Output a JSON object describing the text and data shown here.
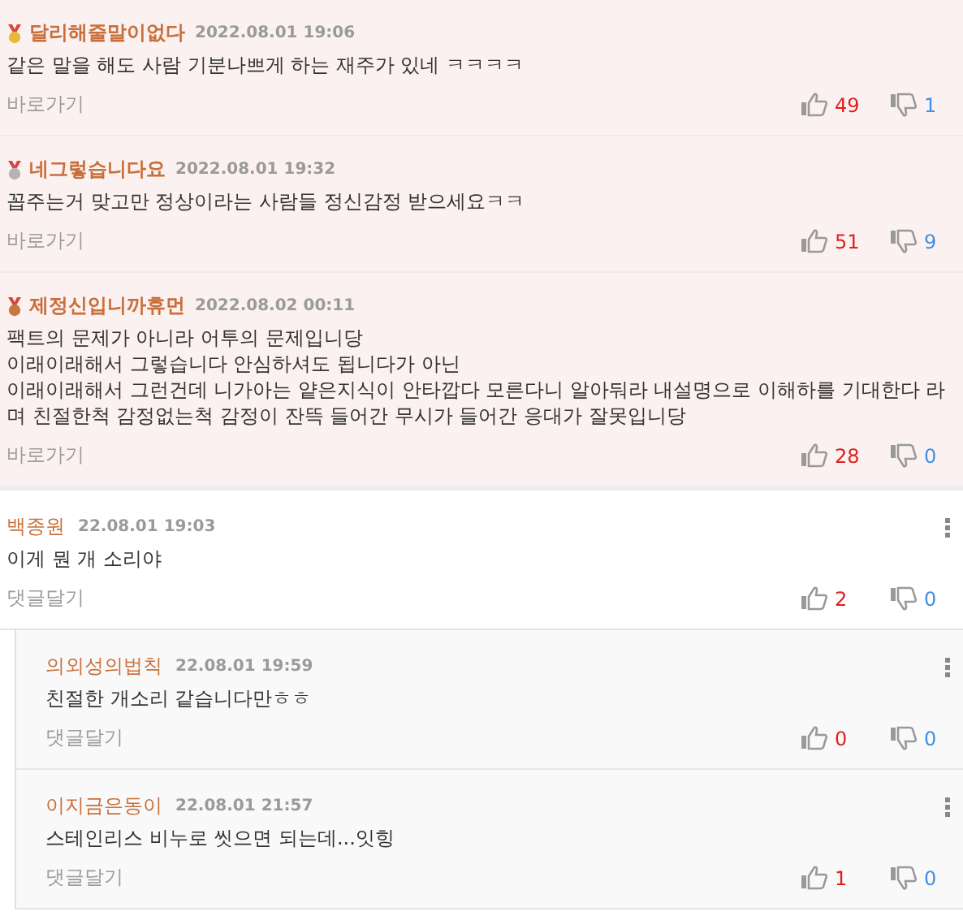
{
  "best_comments": [
    {
      "color": "#e6b93c",
      "author": "달리해줄말이없다",
      "time": "2022.08.01 19:06",
      "lines": [
        "같은 말을 해도 사람 기분나쁘게 하는 재주가 있네 ㅋㅋㅋㅋ"
      ],
      "link": "바로가기",
      "likes": "49",
      "dislikes": "1"
    },
    {
      "color": "#b4b4b4",
      "author": "네그렇습니다요",
      "time": "2022.08.01 19:32",
      "lines": [
        "꼽주는거 맞고만 정상이라는 사람들 정신감정 받으세요ㅋㅋ"
      ],
      "link": "바로가기",
      "likes": "51",
      "dislikes": "9"
    },
    {
      "color": "#c7773f",
      "author": "제정신입니까휴먼",
      "time": "2022.08.02 00:11",
      "lines": [
        "팩트의 문제가 아니라 어투의 문제입니당",
        "이래이래해서 그렇습니다 안심하셔도 됩니다가 아닌",
        "이래이래해서 그런건데 니가아는 얕은지식이 안타깝다 모른다니 알아둬라 내설명으로 이해하를 기대한다 라며 친절한척 감정없는척 감정이 잔뜩 들어간 무시가 들어간 응대가 잘못입니당"
      ],
      "link": "바로가기",
      "likes": "28",
      "dislikes": "0"
    }
  ],
  "comments": [
    {
      "author": "백종원",
      "time": "22.08.01 19:03",
      "text": "이게 뭔 개 소리야",
      "link": "댓글달기",
      "likes": "2",
      "dislikes": "0",
      "replies": [
        {
          "author": "의외성의법칙",
          "time": "22.08.01 19:59",
          "text": "친절한 개소리 같습니다만ㅎㅎ",
          "link": "댓글달기",
          "likes": "0",
          "dislikes": "0"
        },
        {
          "author": "이지금은동이",
          "time": "22.08.01 21:57",
          "text": "스테인리스 비누로 씻으면 되는데...잇힝",
          "link": "댓글달기",
          "likes": "1",
          "dislikes": "0"
        }
      ]
    }
  ]
}
